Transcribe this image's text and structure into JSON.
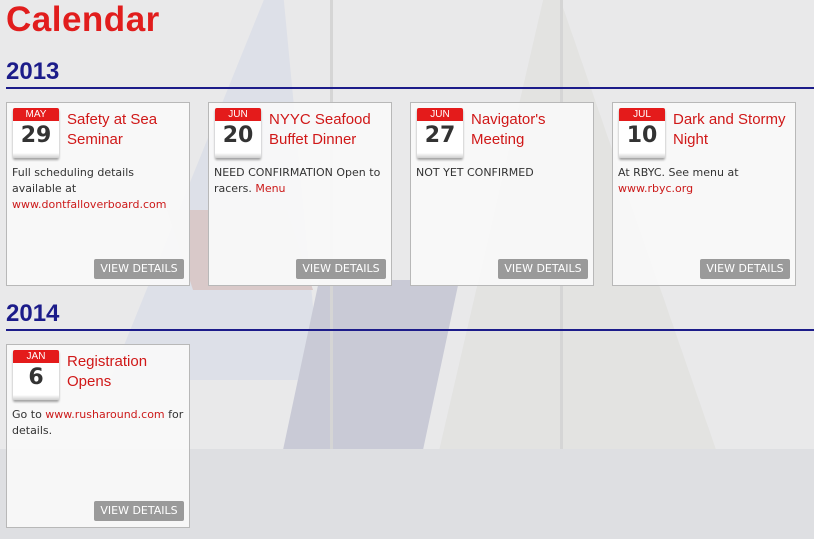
{
  "page": {
    "title": "Calendar"
  },
  "colors": {
    "title": "#e11d1d",
    "year": "#1c1c8a",
    "month_band": "#e41b1b",
    "link": "#cc1a1a",
    "button": "#9a9a9a"
  },
  "years": [
    {
      "year": "2013",
      "events": [
        {
          "month": "MAY",
          "day": "29",
          "title": "Safety at Sea Seminar",
          "desc_text": "Full scheduling details available at ",
          "link_text": "www.dontfalloverboard.com",
          "desc_after": "",
          "button": "VIEW DETAILS"
        },
        {
          "month": "JUN",
          "day": "20",
          "title": "NYYC Seafood Buffet Dinner",
          "desc_text": "NEED CONFIRMATION Open to racers. ",
          "link_text": "Menu",
          "desc_after": "",
          "button": "VIEW DETAILS"
        },
        {
          "month": "JUN",
          "day": "27",
          "title": "Navigator's Meeting",
          "desc_text": "NOT YET CONFIRMED",
          "link_text": "",
          "desc_after": "",
          "button": "VIEW DETAILS"
        },
        {
          "month": "JUL",
          "day": "10",
          "title": "Dark and Stormy Night",
          "desc_text": "At RBYC.  See menu at ",
          "link_text": "www.rbyc.org",
          "desc_after": "",
          "button": "VIEW DETAILS"
        }
      ]
    },
    {
      "year": "2014",
      "events": [
        {
          "month": "JAN",
          "day": "6",
          "title": "Registration Opens",
          "desc_text": "Go to ",
          "link_text": "www.rusharound.com",
          "desc_after": " for details.",
          "button": "VIEW DETAILS"
        }
      ]
    }
  ]
}
